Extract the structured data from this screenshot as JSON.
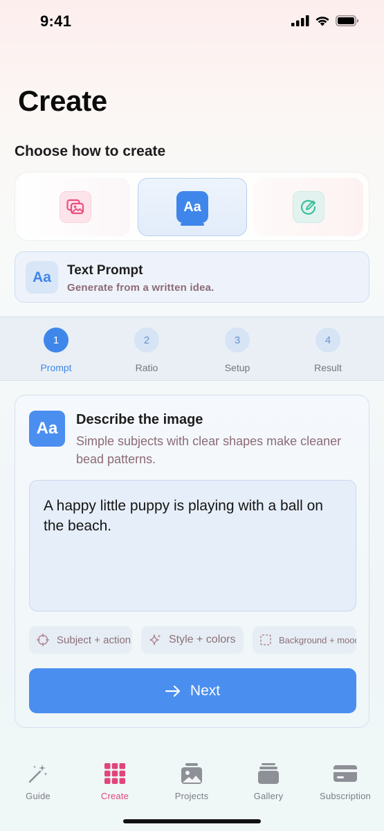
{
  "status_bar": {
    "time": "9:41"
  },
  "page": {
    "title": "Create"
  },
  "choose": {
    "heading": "Choose how to create",
    "modes": [
      {
        "name": "image",
        "icon": "images-icon",
        "active": false
      },
      {
        "name": "text",
        "icon_text": "Aa",
        "active": true
      },
      {
        "name": "sketch",
        "icon": "sketch-icon",
        "active": false
      }
    ]
  },
  "selected_mode": {
    "icon_text": "Aa",
    "title": "Text Prompt",
    "subtitle": "Generate from a written idea."
  },
  "stepper": {
    "steps": [
      {
        "number": "1",
        "label": "Prompt",
        "active": true
      },
      {
        "number": "2",
        "label": "Ratio",
        "active": false
      },
      {
        "number": "3",
        "label": "Setup",
        "active": false
      },
      {
        "number": "4",
        "label": "Result",
        "active": false
      }
    ]
  },
  "describe": {
    "icon_text": "Aa",
    "title": "Describe the image",
    "subtitle": "Simple subjects with clear shapes make cleaner bead patterns.",
    "prompt_value": "A happy little puppy is playing with a ball on the beach.",
    "chips": [
      {
        "label": "Subject + action",
        "icon": "crosshair-icon"
      },
      {
        "label": "Style + colors",
        "icon": "sparkle-icon"
      },
      {
        "label": "Background + mood",
        "icon": "dashed-square-icon"
      }
    ],
    "next_label": "Next"
  },
  "tab_bar": {
    "tabs": [
      {
        "label": "Guide",
        "icon": "magic-wand-icon",
        "active": false
      },
      {
        "label": "Create",
        "icon": "grid-icon",
        "active": true
      },
      {
        "label": "Projects",
        "icon": "photo-stack-icon",
        "active": false
      },
      {
        "label": "Gallery",
        "icon": "gallery-stack-icon",
        "active": false
      },
      {
        "label": "Subscription",
        "icon": "card-icon",
        "active": false
      }
    ]
  },
  "colors": {
    "accent": "#4a8ef0",
    "tab_active": "#e0457b",
    "muted_text": "#8c6a75"
  }
}
